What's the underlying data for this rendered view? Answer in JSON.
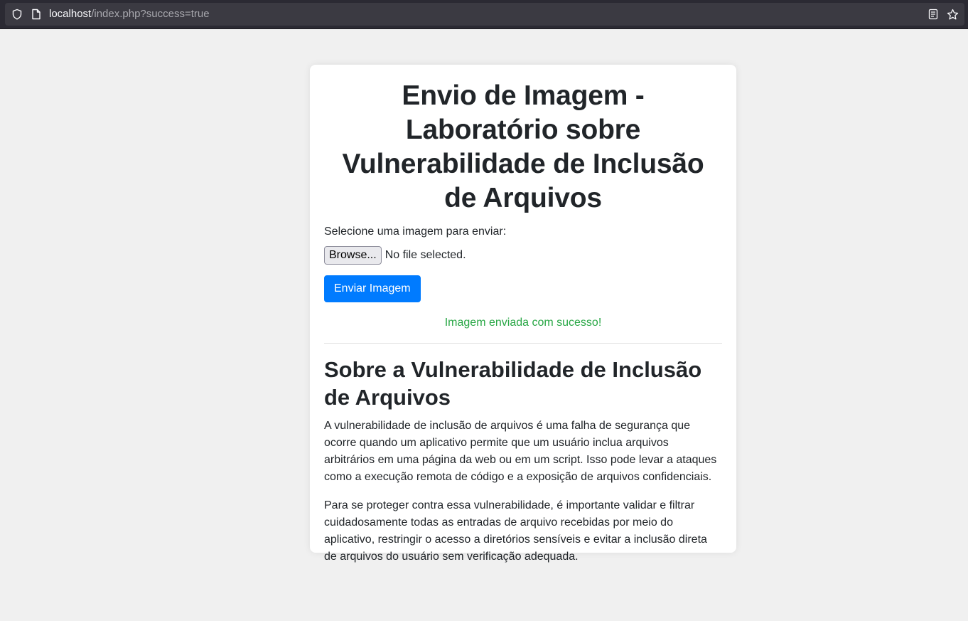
{
  "browser": {
    "url_host": "localhost",
    "url_path": "/index.php?success=true",
    "icons": [
      "shield-icon",
      "page-icon",
      "reader-view-icon",
      "bookmark-star-icon"
    ]
  },
  "card": {
    "title": "Envio de Imagem - Laboratório sobre Vulnerabilidade de Inclusão de Arquivos",
    "upload_label": "Selecione uma imagem para enviar:",
    "browse_label": "Browse...",
    "file_status": "No file selected.",
    "submit_label": "Enviar Imagem",
    "success_message": "Imagem enviada com sucesso!",
    "section_title": "Sobre a Vulnerabilidade de Inclusão de Arquivos",
    "paragraph_1": "A vulnerabilidade de inclusão de arquivos é uma falha de segurança que ocorre quando um aplicativo permite que um usuário inclua arquivos arbitrários em uma página da web ou em um script. Isso pode levar a ataques como a execução remota de código e a exposição de arquivos confidenciais.",
    "paragraph_2": "Para se proteger contra essa vulnerabilidade, é importante validar e filtrar cuidadosamente todas as entradas de arquivo recebidas por meio do aplicativo, restringir o acesso a diretórios sensíveis e evitar a inclusão direta de arquivos do usuário sem verificação adequada."
  },
  "colors": {
    "accent": "#007bff",
    "success": "#28a745",
    "page_bg": "#f0f0f0"
  }
}
